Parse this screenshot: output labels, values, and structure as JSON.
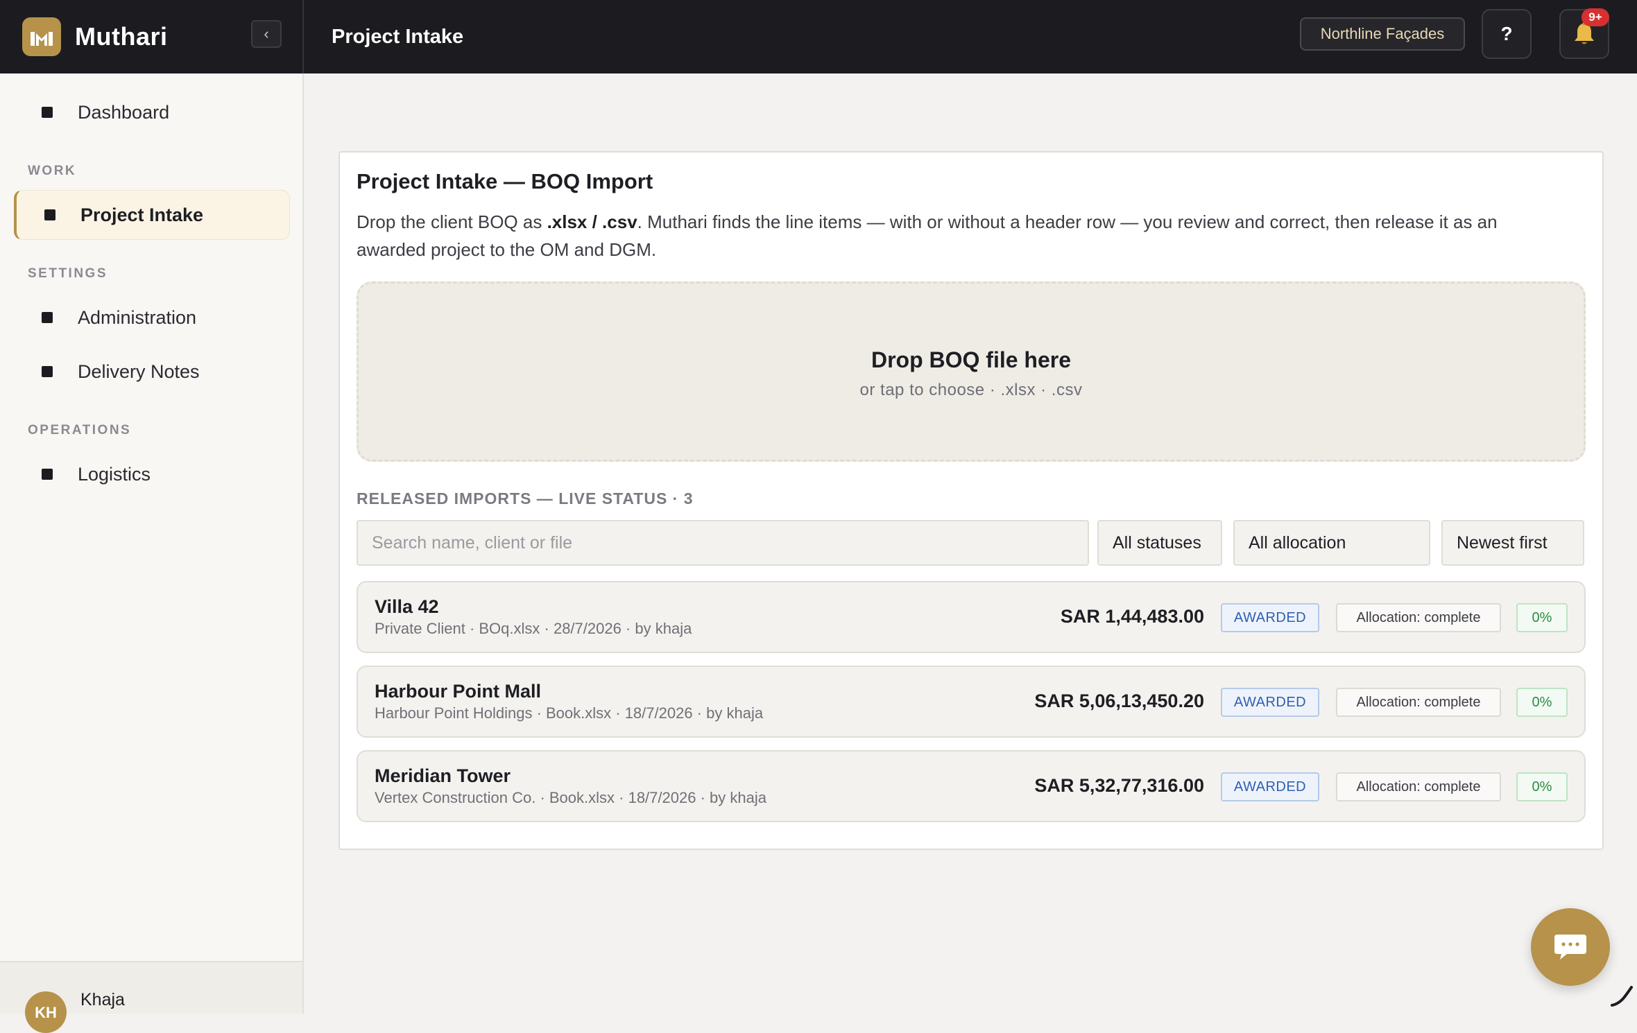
{
  "app": {
    "brand": "Muthari",
    "page_title": "Project Intake",
    "organization": "Northline Façades",
    "help_label": "?",
    "notification_badge": "9+",
    "collapse_label": "‹"
  },
  "sidebar": {
    "items": [
      {
        "label": "Dashboard"
      },
      {
        "section": "WORK"
      },
      {
        "label": "Project Intake",
        "active": true
      },
      {
        "section": "SETTINGS"
      },
      {
        "label": "Administration"
      },
      {
        "label": "Delivery Notes"
      },
      {
        "section": "OPERATIONS"
      },
      {
        "label": "Logistics"
      }
    ],
    "user": {
      "initials": "KH",
      "name": "Khaja"
    }
  },
  "intake": {
    "title": "Project Intake — BOQ Import",
    "desc_before": "Drop the client BOQ as ",
    "desc_formats": ".xlsx / .csv",
    "desc_after": ". Muthari finds the line items — with or without a header row — you review and correct, then release it as an awarded project to the OM and DGM.",
    "drop_title": "Drop BOQ file here",
    "drop_subtitle": "or tap to choose · .xlsx · .csv"
  },
  "imports": {
    "section_label": "RELEASED IMPORTS — LIVE STATUS · 3",
    "search_placeholder": "Search name, client or file",
    "filters": {
      "status": "All statuses",
      "allocation": "All allocation",
      "sort": "Newest first"
    },
    "rows": [
      {
        "name": "Villa 42",
        "meta": "Private Client · BOq.xlsx · 28/7/2026 · by khaja",
        "amount": "SAR 1,44,483.00",
        "status": "AWARDED",
        "allocation": "Allocation: complete",
        "progress": "0%"
      },
      {
        "name": "Harbour Point Mall",
        "meta": "Harbour Point Holdings · Book.xlsx · 18/7/2026 · by khaja",
        "amount": "SAR 5,06,13,450.20",
        "status": "AWARDED",
        "allocation": "Allocation: complete",
        "progress": "0%"
      },
      {
        "name": "Meridian Tower",
        "meta": "Vertex Construction Co. · Book.xlsx · 18/7/2026 · by khaja",
        "amount": "SAR 5,32,77,316.00",
        "status": "AWARDED",
        "allocation": "Allocation: complete",
        "progress": "0%"
      }
    ]
  },
  "colors": {
    "brand_gold": "#b6924a",
    "topbar": "#1c1c20",
    "status_blue": "#2f5fb0",
    "progress_green": "#2e8a44",
    "badge_red": "#d63031"
  },
  "icons": {
    "logo": "muthari-logo-icon",
    "help": "question-icon",
    "notifications": "bell-icon",
    "chat": "chat-bubble-icon"
  }
}
